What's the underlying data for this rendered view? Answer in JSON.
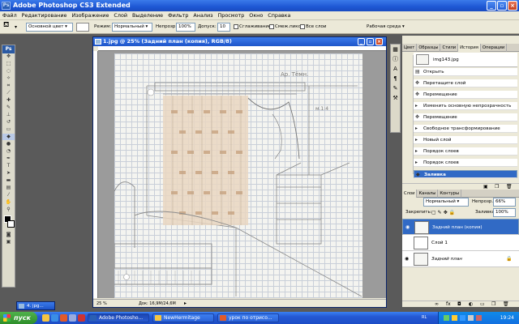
{
  "window": {
    "title": "Adobe Photoshop CS3 Extended",
    "app_icon": "Ps"
  },
  "menu": [
    "Файл",
    "Редактирование",
    "Изображение",
    "Слой",
    "Выделение",
    "Фильтр",
    "Анализ",
    "Просмотр",
    "Окно",
    "Справка"
  ],
  "options_bar": {
    "preset": "Основной цвет",
    "mode_label": "Режим:",
    "mode_value": "Нормальный",
    "opacity_label": "Непрозр.:",
    "opacity_value": "100%",
    "tolerance_label": "Допуск:",
    "tolerance_value": "10",
    "antialias": "Сглаживание",
    "contiguous": "Смеж.пикс",
    "all_layers": "Все слои",
    "workspace": "Рабочая среда"
  },
  "toolbox": {
    "header": "Ps"
  },
  "document": {
    "title": "1.jpg @ 25% (Задний план (копия), RGB/8)",
    "zoom": "25 %",
    "doc_size": "Док: 16,9M/24,6M"
  },
  "history_panel": {
    "tabs": [
      "Цвет",
      "Образцы",
      "Стили",
      "История",
      "Операции"
    ],
    "active_tab": "История",
    "snapshot": "img143.jpg",
    "items": [
      {
        "label": "Открыть",
        "icon": "doc-icon"
      },
      {
        "label": "Перетащите слой",
        "icon": "move-icon"
      },
      {
        "label": "Перемещение",
        "icon": "move-icon"
      },
      {
        "label": "Изменить основную непрозрачность",
        "icon": "step-icon"
      },
      {
        "label": "Перемещение",
        "icon": "move-icon"
      },
      {
        "label": "Свободное трансформирование",
        "icon": "step-icon"
      },
      {
        "label": "Новый слой",
        "icon": "step-icon"
      },
      {
        "label": "Порядок слоев",
        "icon": "step-icon"
      },
      {
        "label": "Порядок слоев",
        "icon": "step-icon"
      },
      {
        "label": "Заливка",
        "icon": "bucket-icon"
      }
    ],
    "selected_index": 9
  },
  "layers_panel": {
    "tabs": [
      "Слои",
      "Каналы",
      "Контуры"
    ],
    "active_tab": "Слои",
    "blend_mode": "Нормальный",
    "opacity_label": "Непрозр.:",
    "opacity_value": "66%",
    "lock_label": "Закрепить:",
    "fill_label": "Заливка:",
    "fill_value": "100%",
    "layers": [
      {
        "name": "Задний план (копия)",
        "visible": true,
        "selected": true
      },
      {
        "name": "Слой 1",
        "visible": false,
        "selected": false
      },
      {
        "name": "Задний план",
        "visible": true,
        "selected": false,
        "locked": true
      }
    ]
  },
  "mini_doc": {
    "title": "4. jpg..."
  },
  "taskbar": {
    "start": "пуск",
    "tasks": [
      "Adobe Photosho...",
      "NewHermitage",
      "урок по отрисо..."
    ],
    "active_task": 0,
    "lang": "RL",
    "clock": "19:24"
  },
  "sketch_notes": [
    "Ар. Тёмн.",
    "м.1:4"
  ],
  "colors": {
    "xp_blue": "#245edb",
    "selection": "#316ac5",
    "panel": "#ece9d8"
  }
}
